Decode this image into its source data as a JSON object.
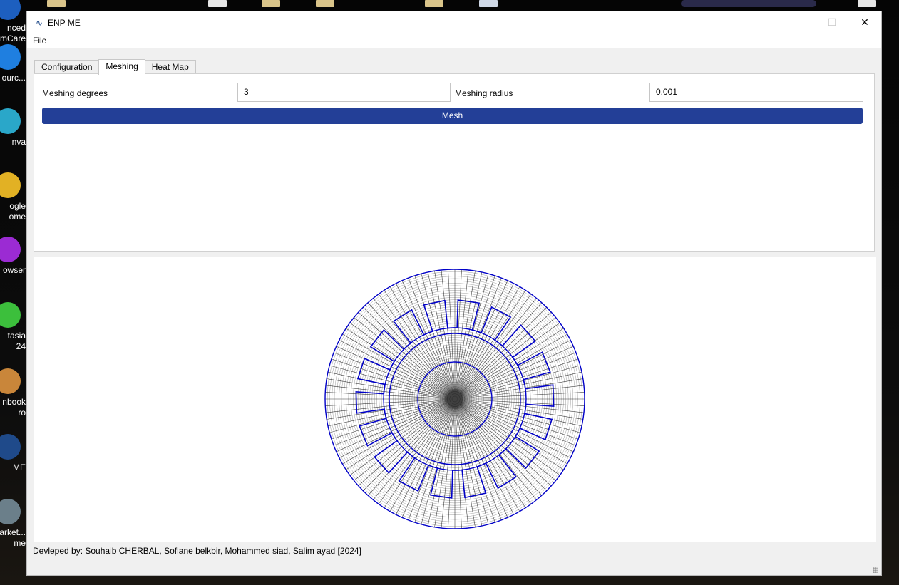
{
  "desktop": {
    "icons": [
      {
        "label": "nced\nmCare",
        "color": "#1d5fbf"
      },
      {
        "label": "ourc...",
        "color": "#1f7fe0"
      },
      {
        "label": "nva",
        "color": "#2aa7c9"
      },
      {
        "label": "ogle\nome",
        "color": "#e2b124"
      },
      {
        "label": "owser",
        "color": "#9b2bd3"
      },
      {
        "label": "tasia\n24",
        "color": "#3cbf3c"
      },
      {
        "label": "nbook\nro",
        "color": "#c9863a"
      },
      {
        "label": "ME",
        "color": "#1f4a8a"
      },
      {
        "label": "arket...\nme",
        "color": "#6b7f8a"
      }
    ]
  },
  "window": {
    "title": "ENP ME",
    "minimize": "—",
    "maximize": "☐",
    "close": "✕"
  },
  "menu": {
    "file": "File"
  },
  "tabs": [
    {
      "label": "Configuration",
      "active": false
    },
    {
      "label": "Meshing",
      "active": true
    },
    {
      "label": "Heat Map",
      "active": false
    }
  ],
  "meshing": {
    "degrees_label": "Meshing degrees",
    "degrees_value": "3",
    "radius_label": "Meshing radius",
    "radius_value": "0.001",
    "mesh_button": "Mesh"
  },
  "footer": {
    "credits": "Devleped by: Souhaib CHERBAL, Sofiane belkbir, Mohammed siad, Salim ayad [2024]"
  },
  "colors": {
    "accent": "#233f97",
    "outline": "#0000c8",
    "mesh": "#000000"
  },
  "mesh": {
    "step_degrees": 3,
    "slots": 18
  }
}
